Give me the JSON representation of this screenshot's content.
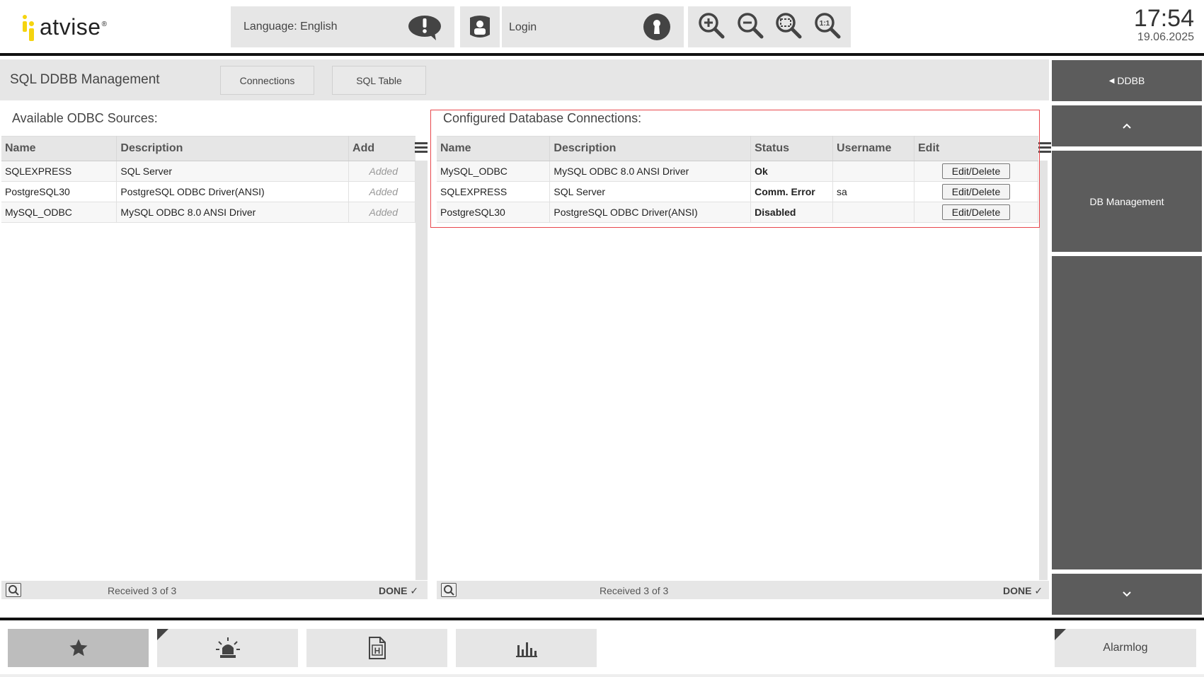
{
  "header": {
    "logo_text": "atvise",
    "logo_reg": "®",
    "language_label": "Language: English",
    "login_label": "Login",
    "time": "17:54",
    "date": "19.06.2025",
    "zoom_icons": [
      "zoom-in-icon",
      "zoom-out-icon",
      "zoom-fit-icon",
      "zoom-reset-icon"
    ],
    "zoom_reset_text": "1:1"
  },
  "page": {
    "title": "SQL DDBB Management",
    "tabs": [
      "Connections",
      "SQL Table"
    ]
  },
  "odbc": {
    "label": "Available ODBC Sources:",
    "columns": [
      "Name",
      "Description",
      "Add"
    ],
    "rows": [
      {
        "name": "SQLEXPRESS",
        "description": "SQL Server",
        "add": "Added"
      },
      {
        "name": "PostgreSQL30",
        "description": "PostgreSQL ODBC Driver(ANSI)",
        "add": "Added"
      },
      {
        "name": "MySQL_ODBC",
        "description": "MySQL ODBC 8.0 ANSI Driver",
        "add": "Added"
      }
    ],
    "footer": {
      "received": "Received",
      "count": "3",
      "of": "of",
      "total": "3",
      "done": "DONE"
    }
  },
  "connections": {
    "label": "Configured Database Connections:",
    "columns": [
      "Name",
      "Description",
      "Status",
      "Username",
      "Edit"
    ],
    "rows": [
      {
        "name": "MySQL_ODBC",
        "description": "MySQL ODBC 8.0 ANSI Driver",
        "status": "Ok",
        "username": "",
        "edit": "Edit/Delete"
      },
      {
        "name": "SQLEXPRESS",
        "description": "SQL Server",
        "status": "Comm. Error",
        "username": "sa",
        "edit": "Edit/Delete"
      },
      {
        "name": "PostgreSQL30",
        "description": "PostgreSQL ODBC Driver(ANSI)",
        "status": "Disabled",
        "username": "",
        "edit": "Edit/Delete"
      }
    ],
    "footer": {
      "received": "Received",
      "count": "3",
      "of": "of",
      "total": "3",
      "done": "DONE"
    }
  },
  "sidebar": {
    "back_label": "DDBB",
    "item_label": "DB Management"
  },
  "bottom": {
    "alarmlog_label": "Alarmlog",
    "icons": [
      "star-icon",
      "alarm-siren-icon",
      "history-document-icon",
      "bar-chart-icon"
    ]
  },
  "colors": {
    "status_ok": "#1aa11a",
    "status_error": "#e01b1b",
    "side_bg": "#5c5c5c",
    "logo_yellow": "#f5d40f",
    "highlight_frame": "#e8474c"
  }
}
